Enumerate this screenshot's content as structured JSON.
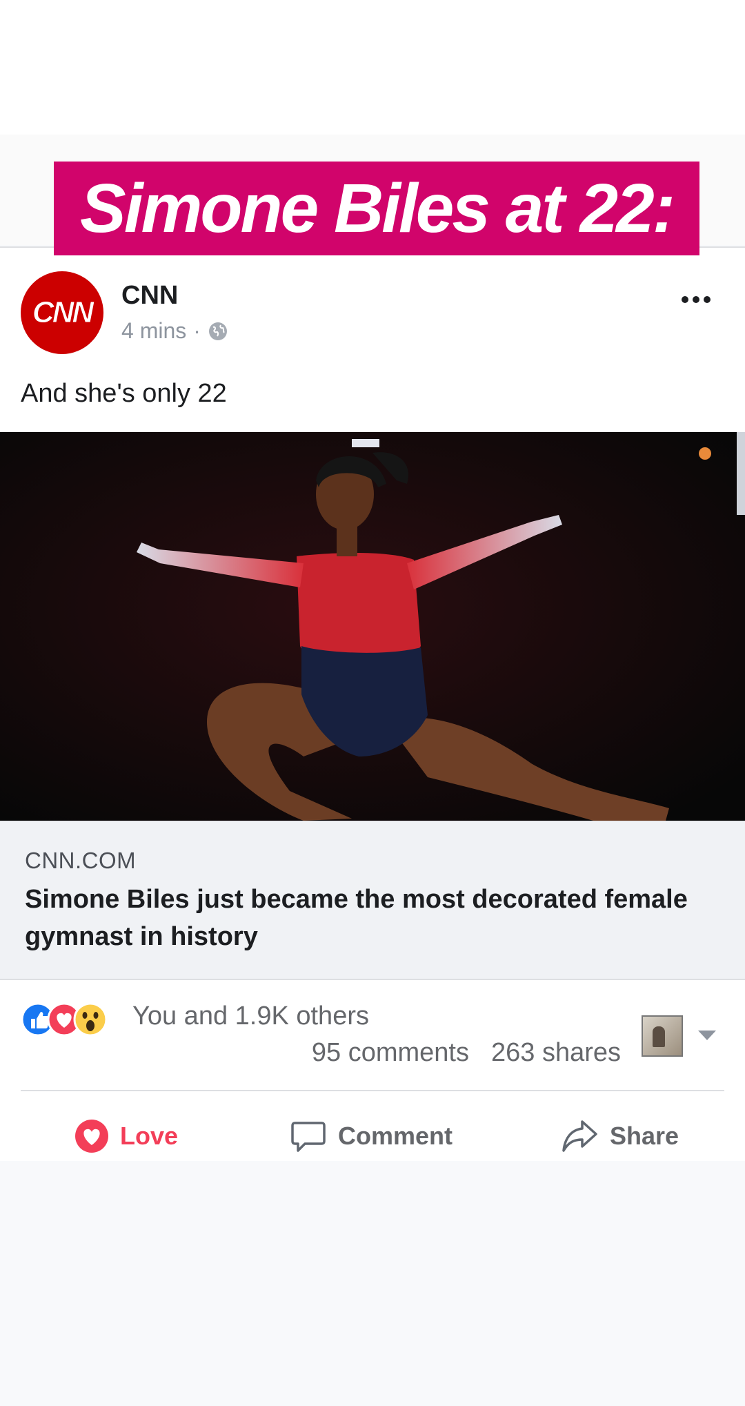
{
  "overlay": {
    "headline": "Simone Biles at 22:"
  },
  "post": {
    "page_name": "CNN",
    "avatar_text": "CNN",
    "time": "4 mins",
    "separator": "·",
    "text": "And she's only 22"
  },
  "link": {
    "domain": "CNN.COM",
    "title": "Simone Biles just became the most decorated female gymnast in history"
  },
  "engagement": {
    "reactions_text": "You and 1.9K others",
    "comments": "95 comments",
    "shares": "263 shares"
  },
  "actions": {
    "love": "Love",
    "comment": "Comment",
    "share": "Share"
  },
  "icons": [
    "globe-icon",
    "more-icon",
    "like-reaction-icon",
    "love-reaction-icon",
    "wow-reaction-icon",
    "heart-icon",
    "comment-icon",
    "share-icon",
    "chevron-down-icon"
  ],
  "colors": {
    "headline_bg": "#d1046b",
    "cnn_red": "#cc0000",
    "love_red": "#f33e58",
    "like_blue": "#1877f2"
  }
}
